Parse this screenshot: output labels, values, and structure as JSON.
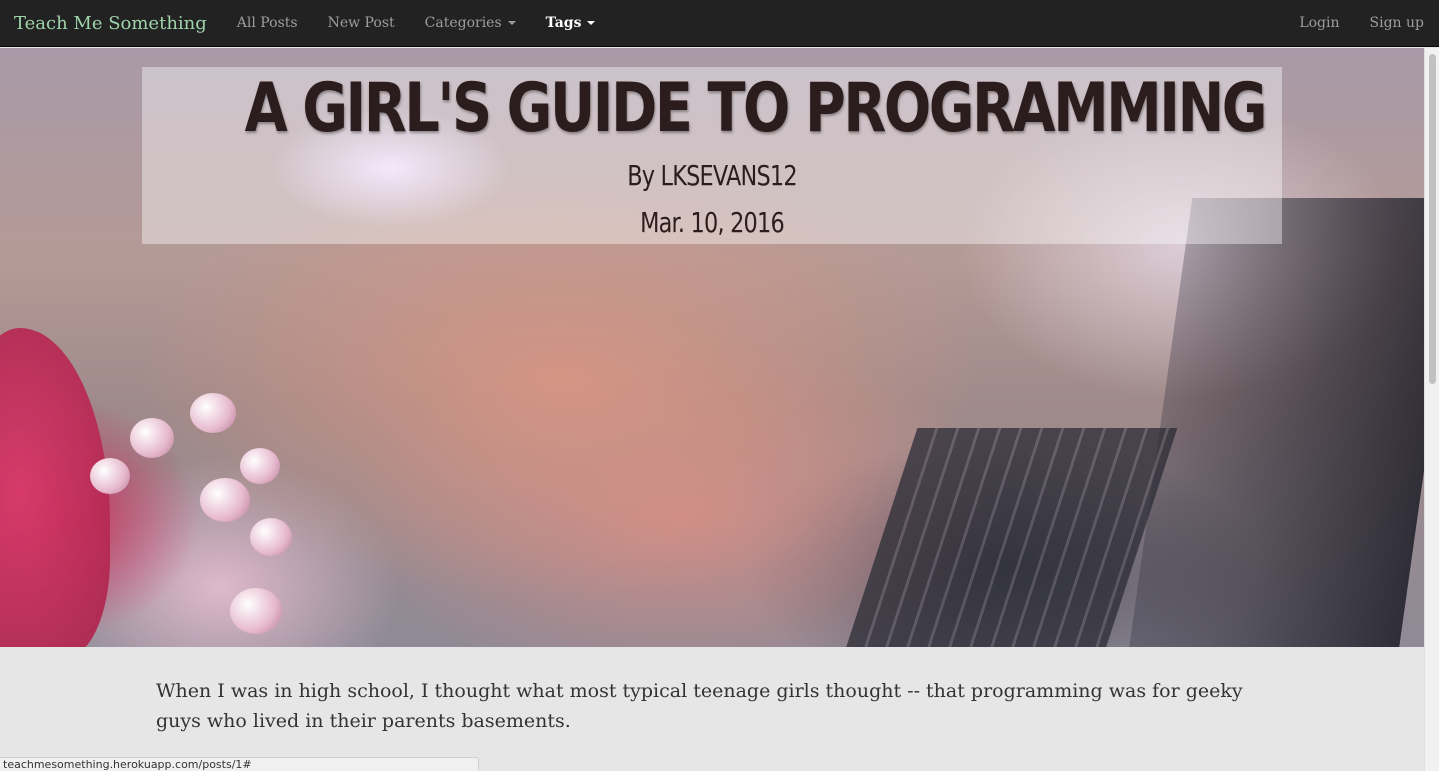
{
  "navbar": {
    "brand": "Teach Me Something",
    "links": {
      "all_posts": "All Posts",
      "new_post": "New Post",
      "categories": "Categories",
      "tags": "Tags"
    },
    "right": {
      "login": "Login",
      "signup": "Sign up"
    },
    "colors": {
      "background": "#222222",
      "brand": "#9fd3aa",
      "link": "#9d9d9d",
      "active_link": "#ffffff"
    }
  },
  "hero": {
    "title": "A GIRL'S GUIDE TO PROGRAMMING",
    "author": "By LKSEVANS12",
    "date": "Mar. 10, 2016"
  },
  "post": {
    "body": "When I was in high school, I thought what most typical teenage girls thought -- that programming was for geeky guys who lived in their parents basements."
  },
  "status_bar": {
    "url": "teachmesomething.herokuapp.com/posts/1#"
  }
}
